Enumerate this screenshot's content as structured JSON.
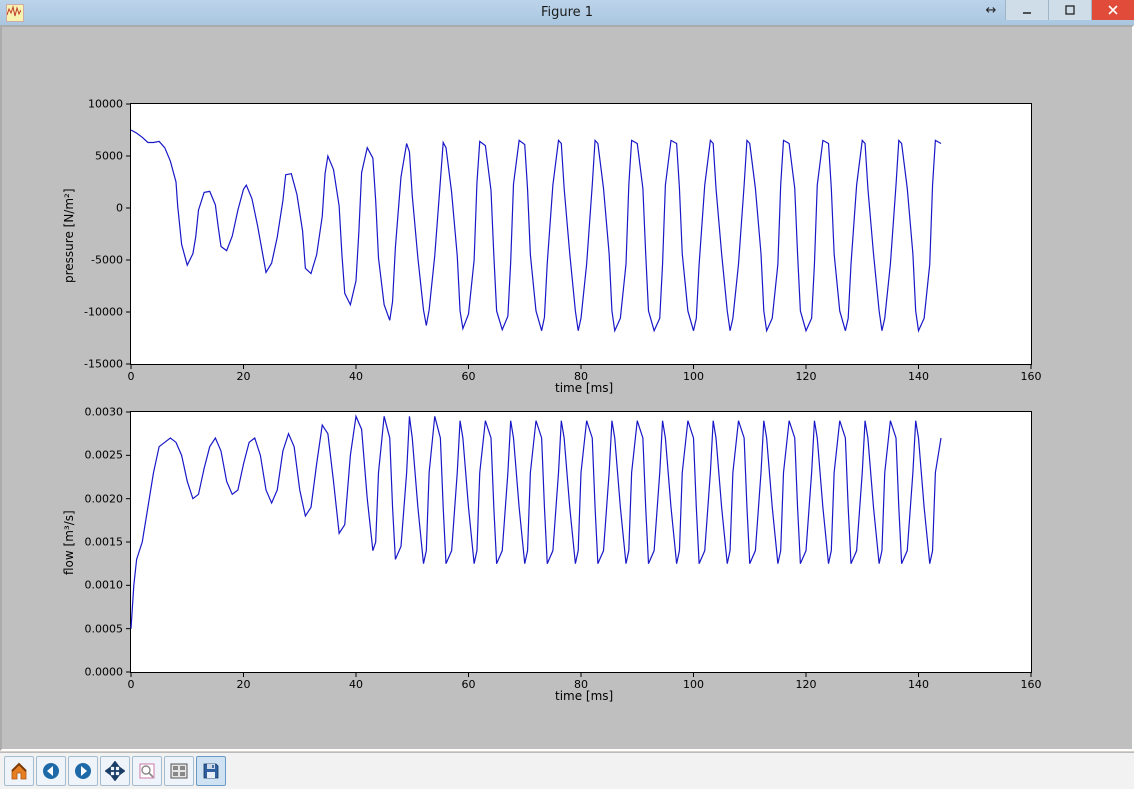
{
  "window": {
    "title": "Figure 1"
  },
  "toolbar": {
    "buttons": [
      {
        "name": "home-button",
        "icon": "home"
      },
      {
        "name": "back-button",
        "icon": "arrow-left"
      },
      {
        "name": "forward-button",
        "icon": "arrow-right"
      },
      {
        "name": "pan-button",
        "icon": "move"
      },
      {
        "name": "zoom-button",
        "icon": "zoom-rect"
      },
      {
        "name": "subplots-button",
        "icon": "subplots"
      },
      {
        "name": "save-button",
        "icon": "save",
        "active": true
      }
    ]
  },
  "chart_data": [
    {
      "type": "line",
      "title": "",
      "xlabel": "time [ms]",
      "ylabel": "pressure [N/m²]",
      "xlim": [
        0,
        160
      ],
      "ylim": [
        -15000,
        10000
      ],
      "xticks": [
        0,
        20,
        40,
        60,
        80,
        100,
        120,
        140,
        160
      ],
      "yticks": [
        -15000,
        -10000,
        -5000,
        0,
        5000,
        10000
      ],
      "series": [
        {
          "name": "pressure",
          "x": [
            0,
            1,
            2,
            3,
            4,
            5,
            6,
            7,
            8,
            8.3,
            9,
            10,
            11,
            11.5,
            12,
            13,
            14,
            15,
            15.5,
            16,
            17,
            18,
            19,
            20,
            20.5,
            21.5,
            22.5,
            23.5,
            24,
            25,
            26,
            27,
            27.5,
            28.5,
            29.5,
            30.5,
            31,
            32,
            33,
            34,
            34.5,
            35,
            36,
            37,
            37.5,
            38,
            39,
            40,
            40.5,
            41,
            42,
            43,
            43.5,
            44,
            45,
            46,
            46.5,
            47,
            48,
            49,
            49.5,
            50,
            51,
            52,
            52.5,
            53,
            54,
            55,
            55.5,
            56,
            57,
            58,
            58.5,
            59,
            60,
            61,
            61.5,
            62,
            63,
            64,
            64.5,
            65,
            66,
            67,
            67.5,
            68,
            69,
            70,
            70.5,
            71,
            72,
            73,
            73.5,
            74,
            75,
            76,
            76.5,
            77,
            78,
            79,
            79.5,
            80,
            81,
            82,
            82.5,
            83,
            84,
            85,
            85.5,
            86,
            87,
            88,
            88.5,
            89,
            90,
            91,
            91.5,
            92,
            93,
            94,
            94.5,
            95,
            96,
            97,
            97.5,
            98,
            99,
            100,
            100.5,
            101,
            102,
            103,
            103.5,
            104,
            105,
            106,
            106.5,
            107,
            108,
            109,
            109.5,
            110,
            111,
            112,
            112.5,
            113,
            114,
            115,
            115.5,
            116,
            117,
            118,
            118.5,
            119,
            120,
            121,
            121.5,
            122,
            123,
            124,
            124.5,
            125,
            126,
            127,
            127.5,
            128,
            129,
            130,
            130.5,
            131,
            132,
            133,
            133.5,
            134,
            135,
            136,
            136.5,
            137,
            138,
            139,
            139.5,
            140,
            141,
            142,
            142.5,
            143,
            144
          ],
          "y": [
            7500,
            7200,
            6800,
            6300,
            6300,
            6400,
            5800,
            4500,
            2500,
            200,
            -3500,
            -5500,
            -4400,
            -2800,
            -200,
            1500,
            1600,
            300,
            -1800,
            -3700,
            -4100,
            -2700,
            -200,
            1800,
            2200,
            900,
            -1700,
            -4700,
            -6200,
            -5300,
            -2800,
            700,
            3200,
            3300,
            1300,
            -2200,
            -5800,
            -6300,
            -4500,
            -800,
            3300,
            5000,
            3700,
            200,
            -4500,
            -8200,
            -9300,
            -7000,
            -2400,
            3400,
            5800,
            4800,
            700,
            -4800,
            -9300,
            -10800,
            -9000,
            -3800,
            3000,
            6200,
            5400,
            1200,
            -4800,
            -9800,
            -11300,
            -9800,
            -4600,
            2600,
            6300,
            5800,
            1500,
            -4600,
            -9900,
            -11600,
            -10200,
            -5000,
            2400,
            6400,
            6000,
            1700,
            -4500,
            -9900,
            -11700,
            -10400,
            -5200,
            2300,
            6500,
            6100,
            1800,
            -4500,
            -9900,
            -11800,
            -10500,
            -5300,
            2200,
            6500,
            6200,
            1900,
            -4400,
            -9900,
            -11800,
            -10600,
            -5400,
            2200,
            6500,
            6200,
            1900,
            -4400,
            -9900,
            -11800,
            -10600,
            -5400,
            2200,
            6500,
            6200,
            1900,
            -4400,
            -9900,
            -11800,
            -10600,
            -5400,
            2200,
            6500,
            6200,
            1900,
            -4400,
            -9900,
            -11800,
            -10600,
            -5400,
            2200,
            6500,
            6200,
            1900,
            -4400,
            -9900,
            -11800,
            -10600,
            -5400,
            2200,
            6500,
            6200,
            1900,
            -4400,
            -9900,
            -11800,
            -10600,
            -5400,
            2200,
            6500,
            6200,
            1900,
            -4400,
            -9900,
            -11800,
            -10600,
            -5400,
            2200,
            6500,
            6200,
            1900,
            -4400,
            -9900,
            -11800,
            -10600,
            -5400,
            2200,
            6500,
            6200,
            1900,
            -4400,
            -9900,
            -11800,
            -10600,
            -5400,
            2200,
            6500,
            6200,
            1900,
            -4400,
            -9900,
            -11800,
            -10600,
            -5400,
            2200,
            6500,
            6200,
            1900,
            -4400,
            -9900,
            -11800,
            -10600,
            -5400,
            2200,
            6000
          ]
        }
      ]
    },
    {
      "type": "line",
      "title": "",
      "xlabel": "time [ms]",
      "ylabel": "flow [m³/s]",
      "xlim": [
        0,
        160
      ],
      "ylim": [
        0.0,
        0.003
      ],
      "xticks": [
        0,
        20,
        40,
        60,
        80,
        100,
        120,
        140,
        160
      ],
      "yticks": [
        0.0,
        0.0005,
        0.001,
        0.0015,
        0.002,
        0.0025,
        0.003
      ],
      "series": [
        {
          "name": "flow",
          "x": [
            0,
            0.5,
            1,
            2,
            3,
            4,
            5,
            6,
            7,
            8,
            9,
            10,
            11,
            12,
            13,
            14,
            15,
            16,
            17,
            18,
            19,
            20,
            21,
            22,
            23,
            24,
            25,
            26,
            27,
            28,
            29,
            30,
            31,
            32,
            33,
            34,
            35,
            36,
            37,
            38,
            39,
            40,
            41,
            42,
            43,
            43.5,
            44,
            45,
            46,
            46.5,
            47,
            48,
            49,
            49.5,
            50,
            51,
            52,
            52.5,
            53,
            54,
            55,
            55.5,
            56,
            57,
            58,
            58.5,
            59,
            60,
            61,
            61.5,
            62,
            63,
            64,
            64.5,
            65,
            66,
            67,
            67.5,
            68,
            69,
            70,
            70.5,
            71,
            72,
            73,
            73.5,
            74,
            75,
            76,
            76.5,
            77,
            78,
            79,
            79.5,
            80,
            81,
            82,
            82.5,
            83,
            84,
            85,
            85.5,
            86,
            87,
            88,
            88.5,
            89,
            90,
            91,
            91.5,
            92,
            93,
            94,
            94.5,
            95,
            96,
            97,
            97.5,
            98,
            99,
            100,
            100.5,
            101,
            102,
            103,
            103.5,
            104,
            105,
            106,
            106.5,
            107,
            108,
            109,
            109.5,
            110,
            111,
            112,
            112.5,
            113,
            114,
            115,
            115.5,
            116,
            117,
            118,
            118.5,
            119,
            120,
            121,
            121.5,
            122,
            123,
            124,
            124.5,
            125,
            126,
            127,
            127.5,
            128,
            129,
            130,
            130.5,
            131,
            132,
            133,
            133.5,
            134,
            135,
            136,
            136.5,
            137,
            138,
            139,
            139.5,
            140,
            141,
            142,
            142.5,
            143,
            144
          ],
          "y": [
            0.0005,
            0.001,
            0.0013,
            0.0015,
            0.0019,
            0.0023,
            0.0026,
            0.00265,
            0.0027,
            0.00265,
            0.0025,
            0.0022,
            0.002,
            0.00205,
            0.00235,
            0.0026,
            0.0027,
            0.00255,
            0.0022,
            0.00205,
            0.0021,
            0.0024,
            0.00265,
            0.0027,
            0.0025,
            0.0021,
            0.00195,
            0.0021,
            0.00255,
            0.00275,
            0.0026,
            0.0021,
            0.0018,
            0.0019,
            0.0024,
            0.00285,
            0.00275,
            0.0022,
            0.0016,
            0.0017,
            0.0025,
            0.00295,
            0.0028,
            0.002,
            0.0014,
            0.0015,
            0.0023,
            0.00295,
            0.0027,
            0.0019,
            0.0013,
            0.00145,
            0.0023,
            0.00295,
            0.0027,
            0.0019,
            0.00125,
            0.0014,
            0.0023,
            0.00295,
            0.0027,
            0.0019,
            0.00125,
            0.0014,
            0.0023,
            0.0029,
            0.0027,
            0.0019,
            0.00125,
            0.0014,
            0.0023,
            0.0029,
            0.0027,
            0.0019,
            0.00125,
            0.0014,
            0.0023,
            0.0029,
            0.0027,
            0.0019,
            0.00125,
            0.0014,
            0.0023,
            0.0029,
            0.0027,
            0.0019,
            0.00125,
            0.0014,
            0.0023,
            0.0029,
            0.0027,
            0.0019,
            0.00125,
            0.0014,
            0.0023,
            0.0029,
            0.0027,
            0.0019,
            0.00125,
            0.0014,
            0.0023,
            0.0029,
            0.0027,
            0.0019,
            0.00125,
            0.0014,
            0.0023,
            0.0029,
            0.0027,
            0.0019,
            0.00125,
            0.0014,
            0.0023,
            0.0029,
            0.0027,
            0.0019,
            0.00125,
            0.0014,
            0.0023,
            0.0029,
            0.0027,
            0.0019,
            0.00125,
            0.0014,
            0.0023,
            0.0029,
            0.0027,
            0.0019,
            0.00125,
            0.0014,
            0.0023,
            0.0029,
            0.0027,
            0.0019,
            0.00125,
            0.0014,
            0.0023,
            0.0029,
            0.0027,
            0.0019,
            0.00125,
            0.0014,
            0.0023,
            0.0029,
            0.0027,
            0.0019,
            0.00125,
            0.0014,
            0.0023,
            0.0029,
            0.0027,
            0.0019,
            0.00125,
            0.0014,
            0.0023,
            0.0029,
            0.0027,
            0.0019,
            0.00125,
            0.0014,
            0.0023,
            0.0029,
            0.0027,
            0.0019,
            0.00125,
            0.0014,
            0.0023,
            0.0029,
            0.0027,
            0.0019,
            0.00125,
            0.0014,
            0.0023,
            0.0029,
            0.0027,
            0.0019,
            0.00125,
            0.0014,
            0.0023,
            0.0027
          ]
        }
      ]
    }
  ]
}
